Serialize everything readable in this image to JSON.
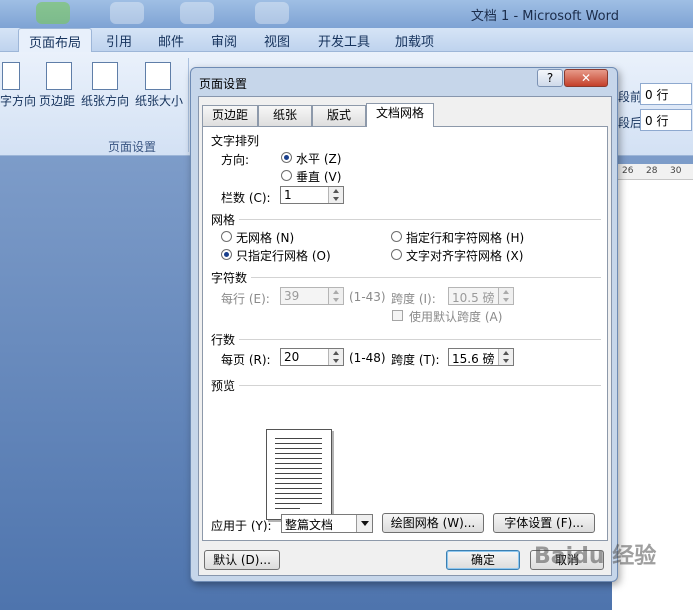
{
  "word": {
    "title": "文档 1 - Microsoft Word",
    "tabs": [
      "页面布局",
      "引用",
      "邮件",
      "审阅",
      "视图",
      "开发工具",
      "加载项"
    ],
    "ribbon_buttons": [
      "字方向",
      "页边距",
      "纸张方向",
      "纸张大小"
    ],
    "group_label": "页面设置",
    "spacing_before_label": "段前:",
    "spacing_before_value": "0 行",
    "spacing_after_label": "段后:",
    "spacing_after_value": "0 行",
    "ruler_marks": [
      "26",
      "28",
      "30"
    ]
  },
  "dialog": {
    "title": "页面设置",
    "help": "?",
    "close": "✕",
    "tabs": [
      "页边距",
      "纸张",
      "版式",
      "文档网格"
    ],
    "active_tab_index": 3,
    "text_direction": {
      "section": "文字排列",
      "direction_label": "方向:",
      "horizontal": "水平 (Z)",
      "vertical": "垂直 (V)",
      "columns_label": "栏数 (C):",
      "columns_value": "1"
    },
    "grid": {
      "section": "网格",
      "no_grid": "无网格 (N)",
      "lines_and_chars": "指定行和字符网格 (H)",
      "lines_only": "只指定行网格 (O)",
      "snap_to_chars": "文字对齐字符网格 (X)",
      "selected": "lines_only"
    },
    "characters": {
      "section": "字符数",
      "per_line_label": "每行 (E):",
      "per_line_value": "39",
      "range": "(1-43)",
      "pitch_label": "跨度 (I):",
      "pitch_value": "10.5 磅",
      "default_pitch": "使用默认跨度 (A)"
    },
    "lines": {
      "section": "行数",
      "per_page_label": "每页 (R):",
      "per_page_value": "20",
      "range": "(1-48)",
      "pitch_label": "跨度 (T):",
      "pitch_value": "15.6 磅"
    },
    "preview_label": "预览",
    "apply_to_label": "应用于 (Y):",
    "apply_to_value": "整篇文档",
    "drawing_grid_button": "绘图网格 (W)...",
    "font_settings_button": "字体设置 (F)...",
    "default_button": "默认 (D)...",
    "ok_button": "确定",
    "cancel_button": "取消"
  },
  "watermark": "Baidu 经验"
}
